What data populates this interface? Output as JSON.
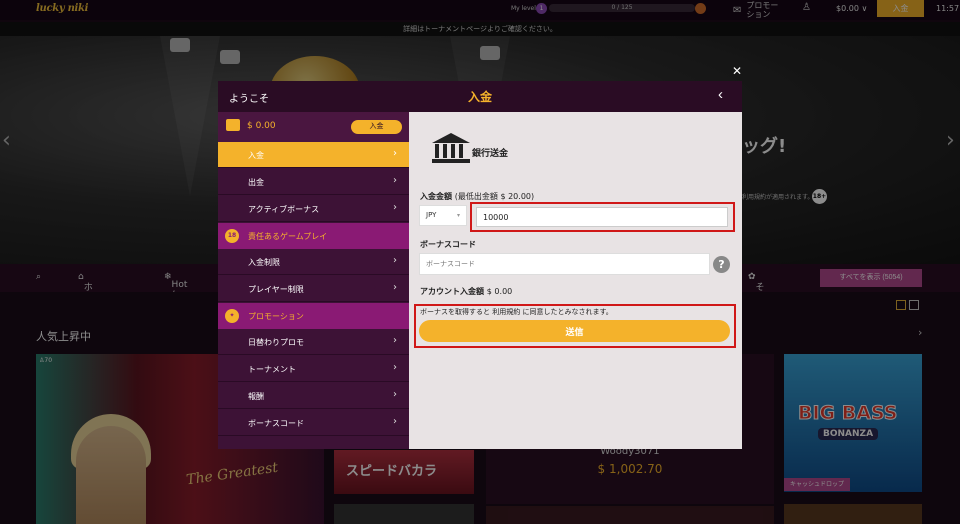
{
  "topbar": {
    "logo": "lucky niki",
    "my_level_label": "My level",
    "level": "1",
    "level_progress": "0 / 125",
    "promotion_label": "プロモー\nション",
    "balance": "$0.00",
    "deposit_label": "入金",
    "time": "11:57"
  },
  "notice": "詳細はトーナメントページよりご確認ください。",
  "hero": {
    "headline": "ッグ!",
    "terms": "利用規約が適用されます。",
    "age": "18+"
  },
  "catnav": {
    "home": "ホーム",
    "hot": "Hot / Cold",
    "other": "その他",
    "show_all": "すべてを表示 (5054)"
  },
  "lobby": {
    "section_title": "人気上昇中",
    "live_seats": "70",
    "live_sign": "The Greatest",
    "speed_game": "スピードバカラ",
    "winner_name": "Woody3071",
    "winner_amount": "$ 1,002.70",
    "bass_title": "BIG BASS",
    "bass_subtitle": "BONANZA",
    "cash_tag": "キャッシュドロップ"
  },
  "modal": {
    "welcome": "ようこそ",
    "title": "入金",
    "sidebar": {
      "balance": "$ 0.00",
      "deposit_button": "入金",
      "items_account": [
        "入金",
        "出金",
        "アクティブボーナス"
      ],
      "responsible_header": "責任あるゲームプレイ",
      "responsible_icon": "18",
      "items_responsible": [
        "入金制限",
        "プレイヤー制限"
      ],
      "promotion_header": "プロモーション",
      "items_promotion": [
        "日替わりプロモ",
        "トーナメント",
        "報酬",
        "ボーナスコード"
      ]
    },
    "panel": {
      "method": "銀行送金",
      "amount_label": "入金金額",
      "amount_min": "(最低出金額 $ 20.00)",
      "currency": "JPY",
      "amount_value": "10000",
      "bonus_label": "ボーナスコード",
      "bonus_placeholder": "ボーナスコード",
      "account_label": "アカウント入金額",
      "account_value": "$ 0.00",
      "terms_text": "ボーナスを取得すると 利用規約 に同意したとみなされます。",
      "submit_label": "送信"
    }
  },
  "colors": {
    "accent": "#f4b22b",
    "header_bg": "#2a0c24",
    "sidebar_bg": "#3d1236",
    "section_header": "#8a1a74",
    "highlight": "#d01818"
  },
  "icons": [
    "search-icon",
    "home-icon",
    "gear-icon",
    "gift-icon",
    "user-icon",
    "chevron-right-icon",
    "back-icon",
    "close-icon",
    "bank-icon",
    "help-icon",
    "wallet-icon",
    "megaphone-icon"
  ]
}
